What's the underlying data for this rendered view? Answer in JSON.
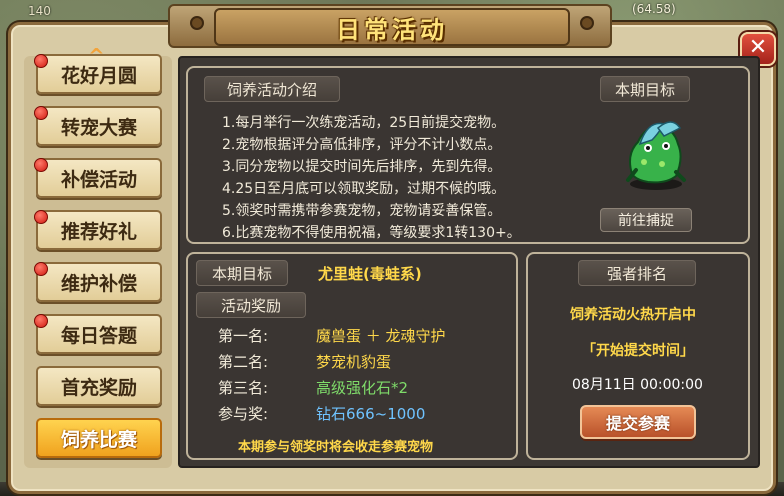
{
  "background": {
    "level_text": "140",
    "coordinates": "(64.58)"
  },
  "window": {
    "title": "日常活动",
    "close_label": "✕"
  },
  "sidebar": {
    "scroll_up": "^",
    "items": [
      {
        "label": "花好月圆",
        "has_dot": true,
        "active": false
      },
      {
        "label": "转宠大赛",
        "has_dot": true,
        "active": false
      },
      {
        "label": "补偿活动",
        "has_dot": true,
        "active": false
      },
      {
        "label": "推荐好礼",
        "has_dot": true,
        "active": false
      },
      {
        "label": "维护补偿",
        "has_dot": true,
        "active": false
      },
      {
        "label": "每日答题",
        "has_dot": true,
        "active": false
      },
      {
        "label": "首充奖励",
        "has_dot": false,
        "active": false
      },
      {
        "label": "饲养比赛",
        "has_dot": false,
        "active": true
      }
    ]
  },
  "intro": {
    "heading": "饲养活动介绍",
    "lines": [
      "1.每月举行一次练宠活动，25日前提交宠物。",
      "2.宠物根据评分高低排序，评分不计小数点。",
      "3.同分宠物以提交时间先后排序，先到先得。",
      "4.25日至月底可以领取奖励，过期不候的哦。",
      "5.领奖时需携带参赛宠物，宠物请妥善保管。",
      "6.比赛宠物不得使用祝福，等级要求1转130+。"
    ]
  },
  "target_box": {
    "heading": "本期目标",
    "button": "前往捕捉"
  },
  "reward": {
    "target_label": "本期目标",
    "target_name": "尤里蛙(毒蛙系)",
    "reward_heading": "活动奖励",
    "rows": [
      {
        "label": "第一名:",
        "value": "魔兽蛋 ＋ 龙魂守护",
        "color": "#ffd84a"
      },
      {
        "label": "第二名:",
        "value": "梦宠机豹蛋",
        "color": "#ffd84a"
      },
      {
        "label": "第三名:",
        "value": "高级强化石*2",
        "color": "#7fdc6a"
      },
      {
        "label": "参与奖:",
        "value": "钻石666~1000",
        "color": "#6fc3ff"
      }
    ],
    "note": "本期参与领奖时将会收走参赛宠物"
  },
  "ranking": {
    "heading": "强者排名",
    "status": "饲养活动火热开启中",
    "start_label": "「开始提交时间」",
    "start_time": "08月11日  00:00:00",
    "submit_button": "提交参赛"
  },
  "colors": {
    "accent_yellow": "#ffd84a",
    "active_tab": "#f0a21e",
    "panel_dark": "#3d3834"
  }
}
